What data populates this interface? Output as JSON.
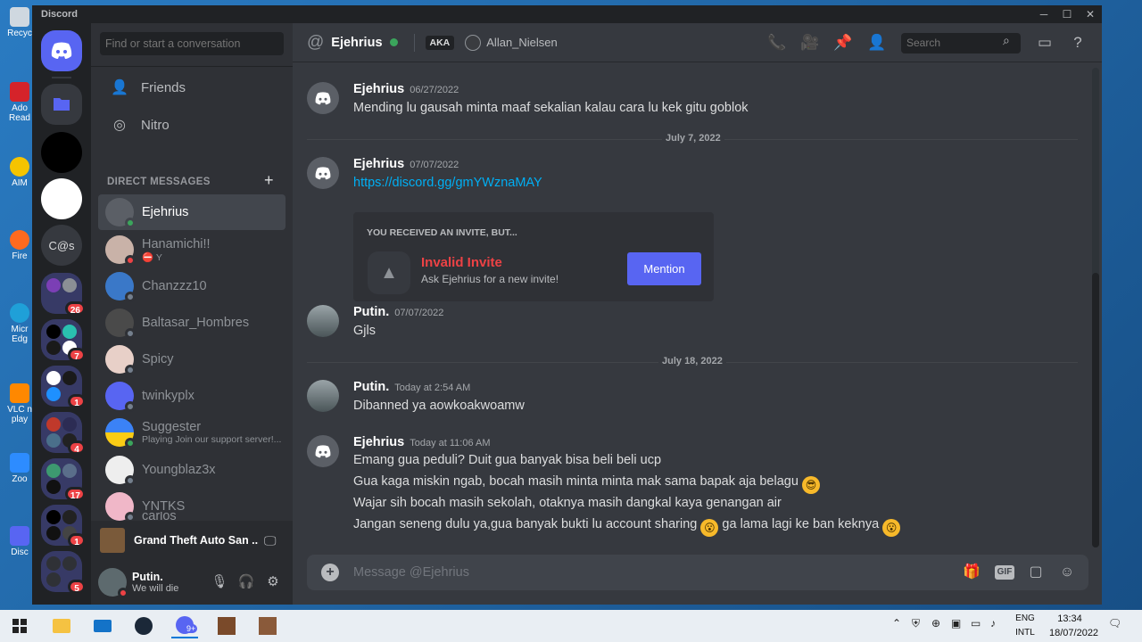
{
  "window": {
    "app_name": "Discord"
  },
  "desktop_icons": [
    {
      "label": "Recyc"
    },
    {
      "label": "Ado Read"
    },
    {
      "label": "AIM"
    },
    {
      "label": "Fire"
    },
    {
      "label": "Micr Edg"
    },
    {
      "label": "VLC n play"
    },
    {
      "label": "Zoo"
    },
    {
      "label": "Disc"
    }
  ],
  "guilds": {
    "server_initials": "C@s",
    "badges": [
      "26",
      "7",
      "1",
      "4",
      "17",
      "1",
      "5"
    ]
  },
  "sidebar": {
    "search_placeholder": "Find or start a conversation",
    "nav": {
      "friends": "Friends",
      "nitro": "Nitro"
    },
    "dm_header": "DIRECT MESSAGES",
    "dms": [
      {
        "name": "Ejehrius",
        "sub": ""
      },
      {
        "name": "Hanamichi!!",
        "sub": "Y"
      },
      {
        "name": "Chanzzz10",
        "sub": ""
      },
      {
        "name": "Baltasar_Hombres",
        "sub": ""
      },
      {
        "name": "Spicy",
        "sub": ""
      },
      {
        "name": "twinkyplx",
        "sub": ""
      },
      {
        "name": "Suggester",
        "sub": "Playing Join our support server!..."
      },
      {
        "name": "Youngblaz3x",
        "sub": ""
      },
      {
        "name": "YNTKS",
        "sub": ""
      },
      {
        "name": "carlos",
        "sub": ""
      }
    ],
    "activity": {
      "game": "Grand Theft Auto San ..."
    },
    "user": {
      "name": "Putin.",
      "status": "We will die"
    }
  },
  "chat": {
    "title": "Ejehrius",
    "aka_label": "AKA",
    "alias": "Allan_Nielsen",
    "search_placeholder": "Search",
    "composer_placeholder": "Message @Ejehrius",
    "gif_label": "GIF",
    "messages": [
      {
        "author": "Ejehrius",
        "time": "06/27/2022",
        "lines": [
          "Mending lu gausah minta maaf sekalian kalau cara lu kek gitu goblok"
        ]
      },
      {
        "author": "Ejehrius",
        "time": "07/07/2022",
        "lines": [
          "https://discord.gg/gmYWznaMAY"
        ]
      },
      {
        "author": "Putin.",
        "time": "07/07/2022",
        "lines": [
          "Gjls"
        ]
      },
      {
        "author": "Putin.",
        "time": "Today at 2:54 AM",
        "lines": [
          "Dibanned ya aowkoakwoamw"
        ]
      },
      {
        "author": "Ejehrius",
        "time": "Today at 11:06 AM",
        "lines": [
          "Emang gua peduli? Duit gua banyak bisa beli beli ucp",
          "Gua kaga miskin ngab, bocah masih minta minta mak sama bapak aja belagu",
          "Wajar sih bocah masih sekolah, otaknya masih dangkal kaya genangan air",
          "Jangan seneng dulu ya,gua banyak bukti lu account sharing",
          "ga lama lagi ke ban keknya"
        ]
      }
    ],
    "dividers": [
      "July 7, 2022",
      "July 18, 2022"
    ],
    "invite": {
      "header": "YOU RECEIVED AN INVITE, BUT...",
      "title": "Invalid Invite",
      "subtitle": "Ask Ejehrius for a new invite!",
      "button": "Mention"
    }
  },
  "taskbar": {
    "steam_badge": "9+",
    "language": [
      "ENG",
      "INTL"
    ],
    "time": "13:34",
    "date": "18/07/2022"
  },
  "colors": {
    "blurple": "#5865f2",
    "online": "#3ba55c",
    "dnd": "#ed4245",
    "link": "#00aff4"
  }
}
